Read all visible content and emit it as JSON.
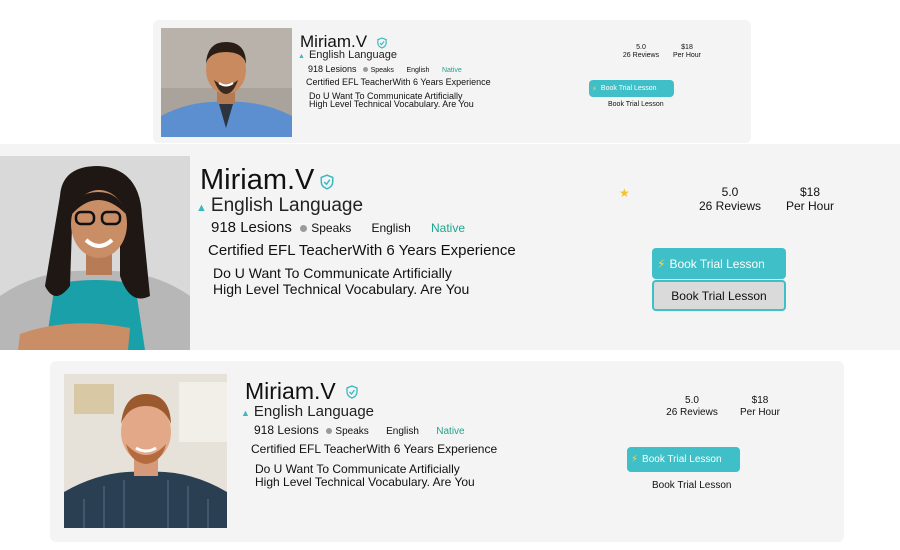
{
  "cards": [
    {
      "name": "Miriam.V",
      "language": "English Language",
      "lessons": "918 Lesions",
      "speaks_label": "Speaks",
      "speaks_lang": "English",
      "native_label": "Native",
      "headline": "Certified EFL TeacherWith 6 Years Experience",
      "desc_line1": "Do U Want To Communicate Artificially",
      "desc_line2": "High Level Technical Vocabulary. Are You",
      "rating": "5.0",
      "reviews": "26 Reviews",
      "price": "$18",
      "price_unit": "Per Hour",
      "primary_button": "Book Trial Lesson",
      "secondary_button": "Book Trial Lesson"
    },
    {
      "name": "Miriam.V",
      "language": "English Language",
      "lessons": "918 Lesions",
      "speaks_label": "Speaks",
      "speaks_lang": "English",
      "native_label": "Native",
      "headline": "Certified EFL TeacherWith 6 Years Experience",
      "desc_line1": "Do U Want To Communicate Artificially",
      "desc_line2": "High Level Technical Vocabulary. Are You",
      "rating": "5.0",
      "reviews": "26 Reviews",
      "price": "$18",
      "price_unit": "Per Hour",
      "primary_button": "Book Trial Lesson",
      "secondary_button": "Book Trial Lesson"
    },
    {
      "name": "Miriam.V",
      "language": "English Language",
      "lessons": "918 Lesions",
      "speaks_label": "Speaks",
      "speaks_lang": "English",
      "native_label": "Native",
      "headline": "Certified EFL TeacherWith 6 Years Experience",
      "desc_line1": "Do U Want To Communicate Artificially",
      "desc_line2": "High Level Technical Vocabulary. Are You",
      "rating": "5.0",
      "reviews": "26 Reviews",
      "price": "$18",
      "price_unit": "Per Hour",
      "primary_button": "Book Trial Lesson",
      "secondary_button": "Book Trial Lesson"
    }
  ],
  "colors": {
    "accent": "#3fbfc7",
    "native": "#1fa58c",
    "star": "#f2c230",
    "card_bg": "#f4f4f4"
  },
  "icons": [
    "verified-shield-icon",
    "graduation-cap-icon",
    "lightning-bolt-icon",
    "star-icon"
  ]
}
